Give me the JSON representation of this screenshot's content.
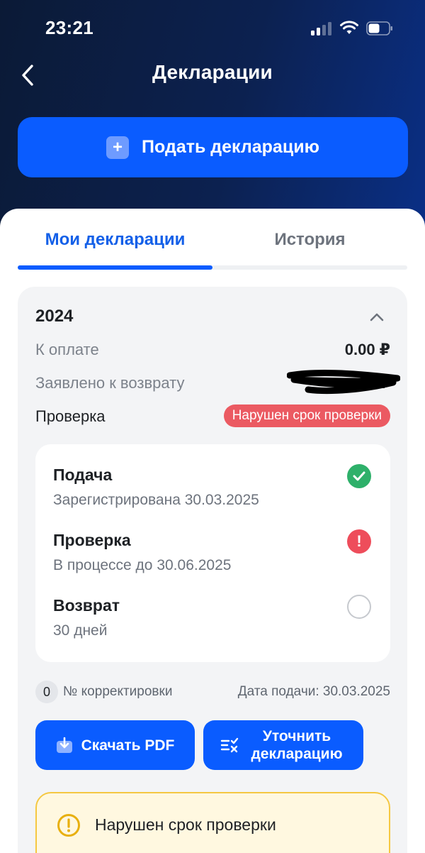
{
  "status_bar": {
    "time": "23:21"
  },
  "header": {
    "title": "Декларации",
    "submit_label": "Подать декларацию"
  },
  "tabs": [
    {
      "label": "Мои декларации",
      "active": true
    },
    {
      "label": "История",
      "active": false
    }
  ],
  "declaration": {
    "year": "2024",
    "rows": {
      "to_pay": {
        "label": "К оплате",
        "value": "0.00 ₽"
      },
      "refund": {
        "label": "Заявлено к возврату",
        "value_suffix": "0 ₽"
      },
      "check": {
        "label": "Проверка",
        "status": "Нарушен срок проверки"
      }
    },
    "steps": [
      {
        "title": "Подача",
        "subtitle": "Зарегистрирована 30.03.2025",
        "state": "done",
        "icon": "check-circle-icon"
      },
      {
        "title": "Проверка",
        "subtitle": "В процессе до 30.06.2025",
        "state": "error",
        "icon": "exclamation-circle-icon"
      },
      {
        "title": "Возврат",
        "subtitle": "30 дней",
        "state": "pending",
        "icon": "empty-circle-icon"
      }
    ],
    "correction_number": "0",
    "correction_label": "№ корректировки",
    "submit_date_label": "Дата подачи: 30.03.2025",
    "actions": {
      "download": "Скачать PDF",
      "clarify": "Уточнить декларацию"
    },
    "warning": "Нарушен срок проверки"
  },
  "colors": {
    "accent": "#0a5cff",
    "success": "#2eb06a",
    "error": "#ee4d5b",
    "warning_border": "#f5c842",
    "warning_bg": "#fff8e0"
  }
}
